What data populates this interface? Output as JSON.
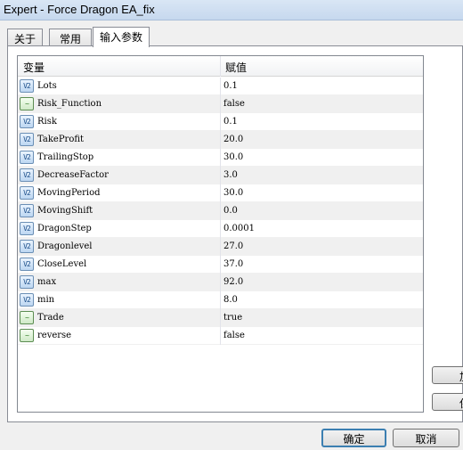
{
  "window": {
    "title": "Expert - Force Dragon EA_fix"
  },
  "tabs": [
    {
      "label": "关于"
    },
    {
      "label": "常用"
    },
    {
      "label": "输入参数"
    }
  ],
  "grid": {
    "headers": {
      "variable": "变量",
      "value": "赋值"
    },
    "rows": [
      {
        "icon": "numeric-param-icon",
        "glyph": "V2",
        "name": "Lots",
        "value": "0.1"
      },
      {
        "icon": "boolean-param-icon",
        "glyph": "~",
        "name": "Risk_Function",
        "value": "false"
      },
      {
        "icon": "numeric-param-icon",
        "glyph": "V2",
        "name": "Risk",
        "value": "0.1"
      },
      {
        "icon": "numeric-param-icon",
        "glyph": "V2",
        "name": "TakeProfit",
        "value": "20.0"
      },
      {
        "icon": "numeric-param-icon",
        "glyph": "V2",
        "name": "TrailingStop",
        "value": "30.0"
      },
      {
        "icon": "numeric-param-icon",
        "glyph": "V2",
        "name": "DecreaseFactor",
        "value": "3.0"
      },
      {
        "icon": "numeric-param-icon",
        "glyph": "V2",
        "name": "MovingPeriod",
        "value": "30.0"
      },
      {
        "icon": "numeric-param-icon",
        "glyph": "V2",
        "name": "MovingShift",
        "value": "0.0"
      },
      {
        "icon": "numeric-param-icon",
        "glyph": "V2",
        "name": "DragonStep",
        "value": "0.0001"
      },
      {
        "icon": "numeric-param-icon",
        "glyph": "V2",
        "name": "Dragonlevel",
        "value": "27.0"
      },
      {
        "icon": "numeric-param-icon",
        "glyph": "V2",
        "name": "CloseLevel",
        "value": "37.0"
      },
      {
        "icon": "numeric-param-icon",
        "glyph": "V2",
        "name": "max",
        "value": "92.0"
      },
      {
        "icon": "numeric-param-icon",
        "glyph": "V2",
        "name": "min",
        "value": "8.0"
      },
      {
        "icon": "boolean-param-icon",
        "glyph": "~",
        "name": "Trade",
        "value": "true"
      },
      {
        "icon": "boolean-param-icon",
        "glyph": "~",
        "name": "reverse",
        "value": "false"
      }
    ]
  },
  "side_buttons": {
    "load": "加",
    "save": "保"
  },
  "buttons": {
    "ok": "确定",
    "cancel": "取消"
  }
}
